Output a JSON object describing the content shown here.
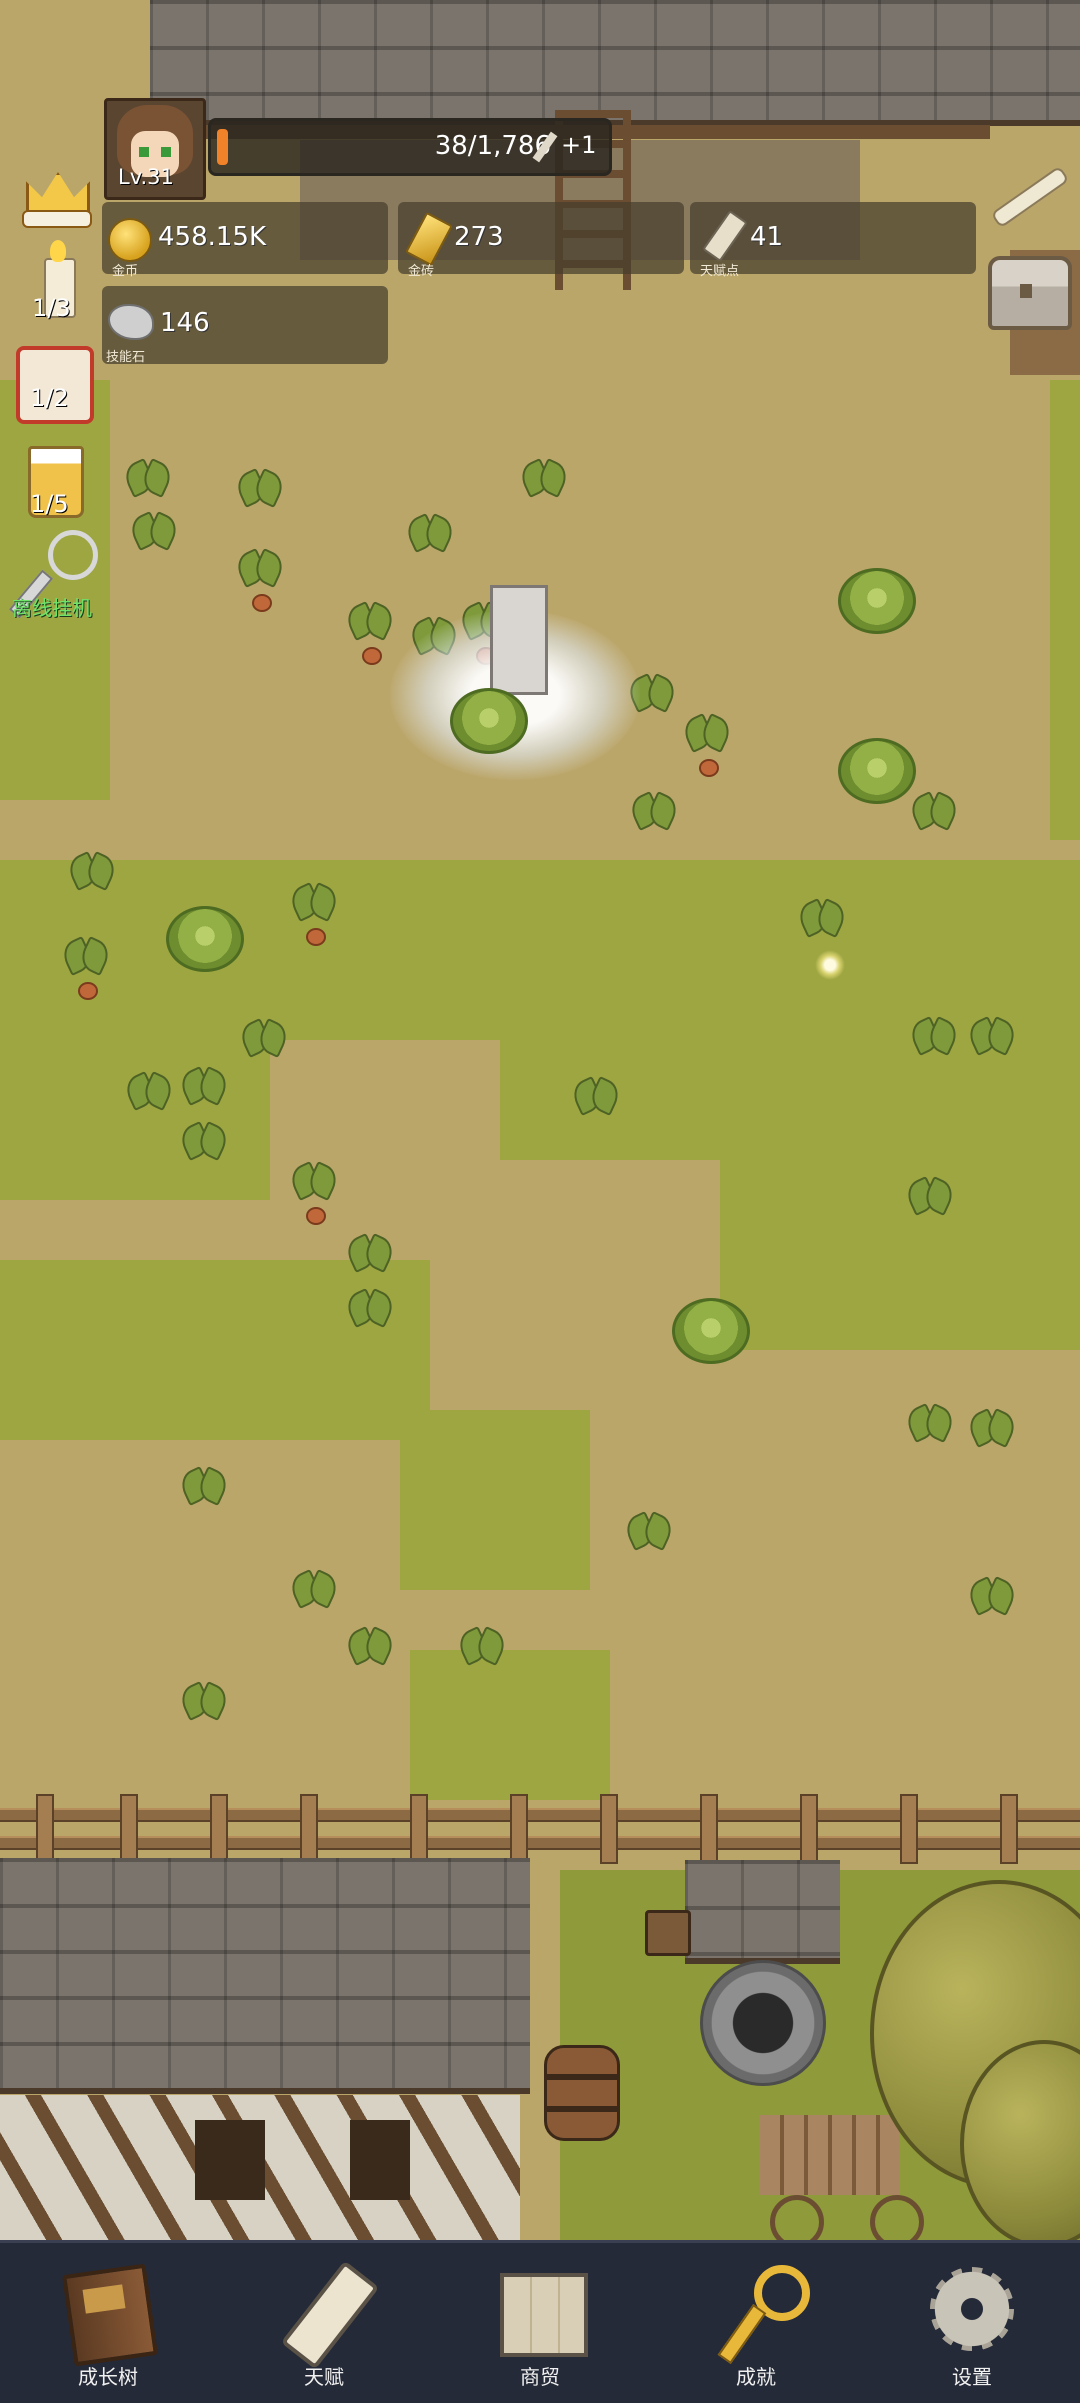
{
  "player": {
    "level": "Lv.31"
  },
  "exp": {
    "text": "38/1,786",
    "current": 38,
    "max": 1786,
    "bonus": "+1"
  },
  "resources": {
    "gold": {
      "value": "458.15K",
      "label": "金币"
    },
    "gold_brick": {
      "value": "273",
      "label": "金砖"
    },
    "talent_points": {
      "value": "41",
      "label": "天赋点"
    },
    "skill_stone": {
      "value": "146",
      "label": "技能石"
    }
  },
  "side_buttons": {
    "candle": {
      "count": "1/3"
    },
    "dice": {
      "count": "1/2"
    },
    "beer": {
      "count": "1/5"
    },
    "idle": {
      "label": "离线挂机",
      "color": "#6ee36a"
    }
  },
  "nav": [
    {
      "label": "成长树",
      "icon": "book-icon"
    },
    {
      "label": "天赋",
      "icon": "scroll-icon"
    },
    {
      "label": "商贸",
      "icon": "map-icon"
    },
    {
      "label": "成就",
      "icon": "key-icon"
    },
    {
      "label": "设置",
      "icon": "gear-icon"
    }
  ]
}
